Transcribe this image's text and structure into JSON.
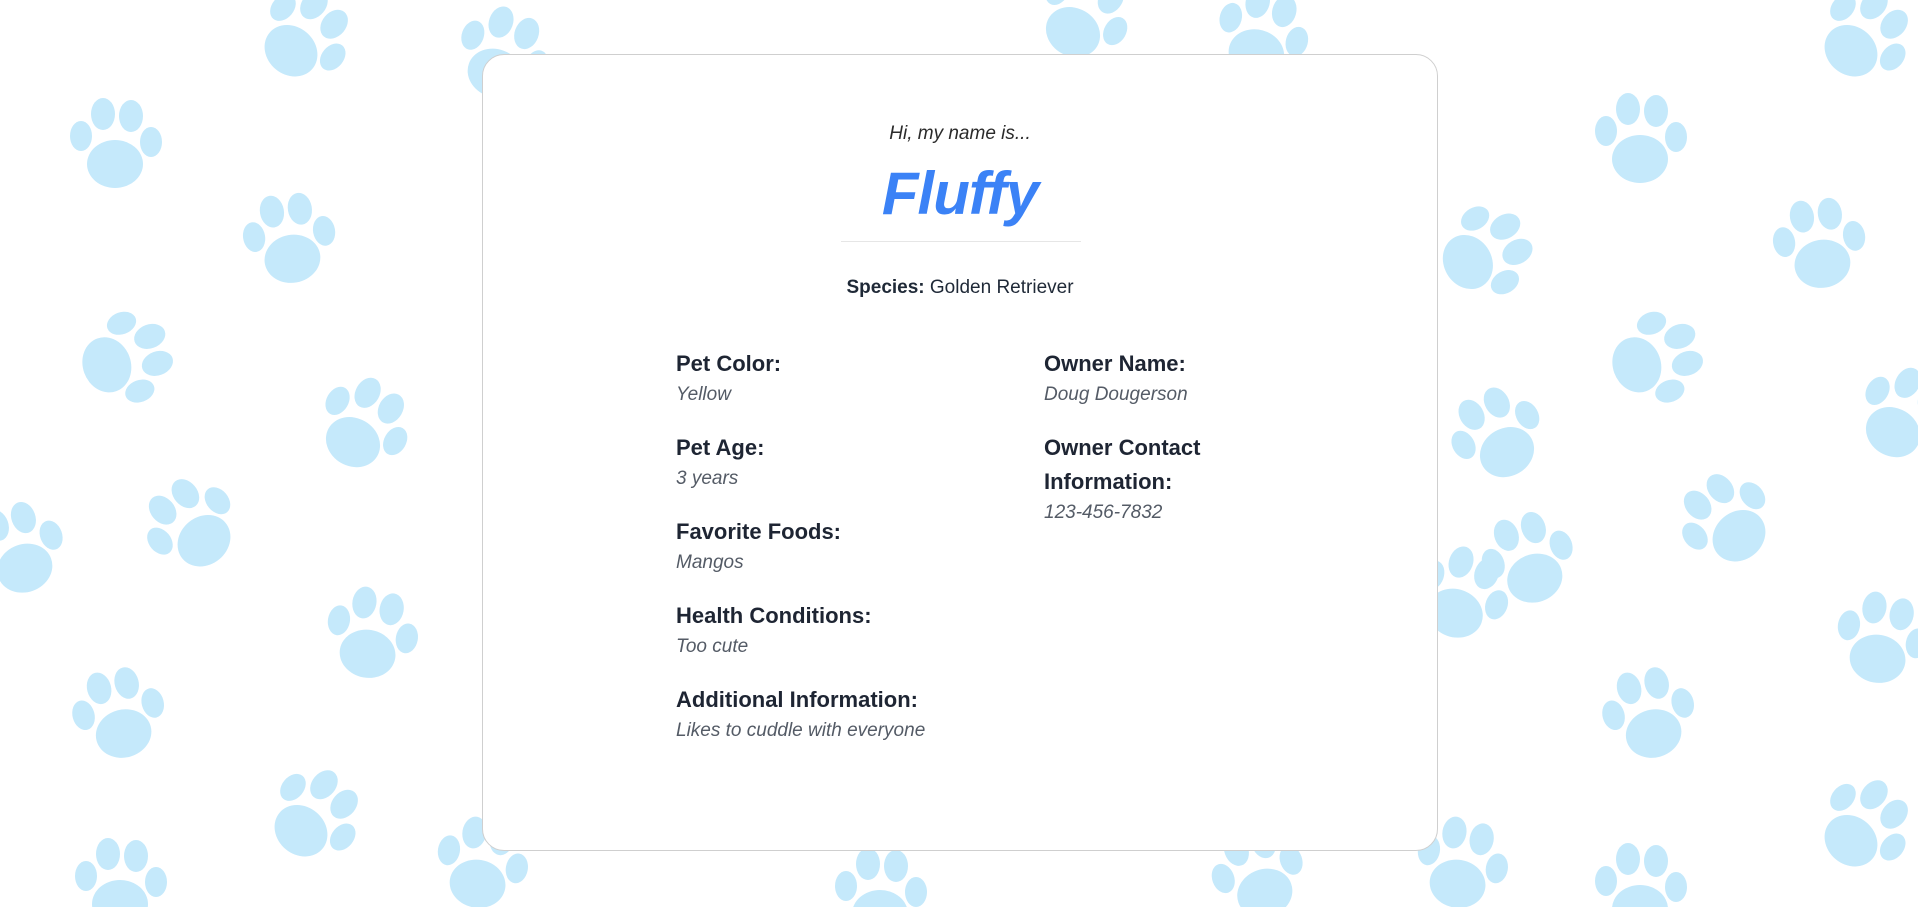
{
  "greeting": "Hi, my name is...",
  "pet_name": "Fluffy",
  "species": {
    "label": "Species:",
    "value": "Golden Retriever"
  },
  "left_fields": [
    {
      "label": "Pet Color:",
      "value": "Yellow"
    },
    {
      "label": "Pet Age:",
      "value": "3 years"
    },
    {
      "label": "Favorite Foods:",
      "value": "Mangos"
    },
    {
      "label": "Health Conditions:",
      "value": "Too cute"
    },
    {
      "label": "Additional Information:",
      "value": "Likes to cuddle with everyone"
    }
  ],
  "right_fields": [
    {
      "label": "Owner Name:",
      "value": "Doug Dougerson"
    },
    {
      "label": "Owner Contact Information:",
      "value": "123-456-7832"
    }
  ],
  "colors": {
    "accent": "#3b82f6",
    "paw": "#c5e9fb",
    "background": "#ffffff"
  },
  "background_icon": "paw-print-icon"
}
